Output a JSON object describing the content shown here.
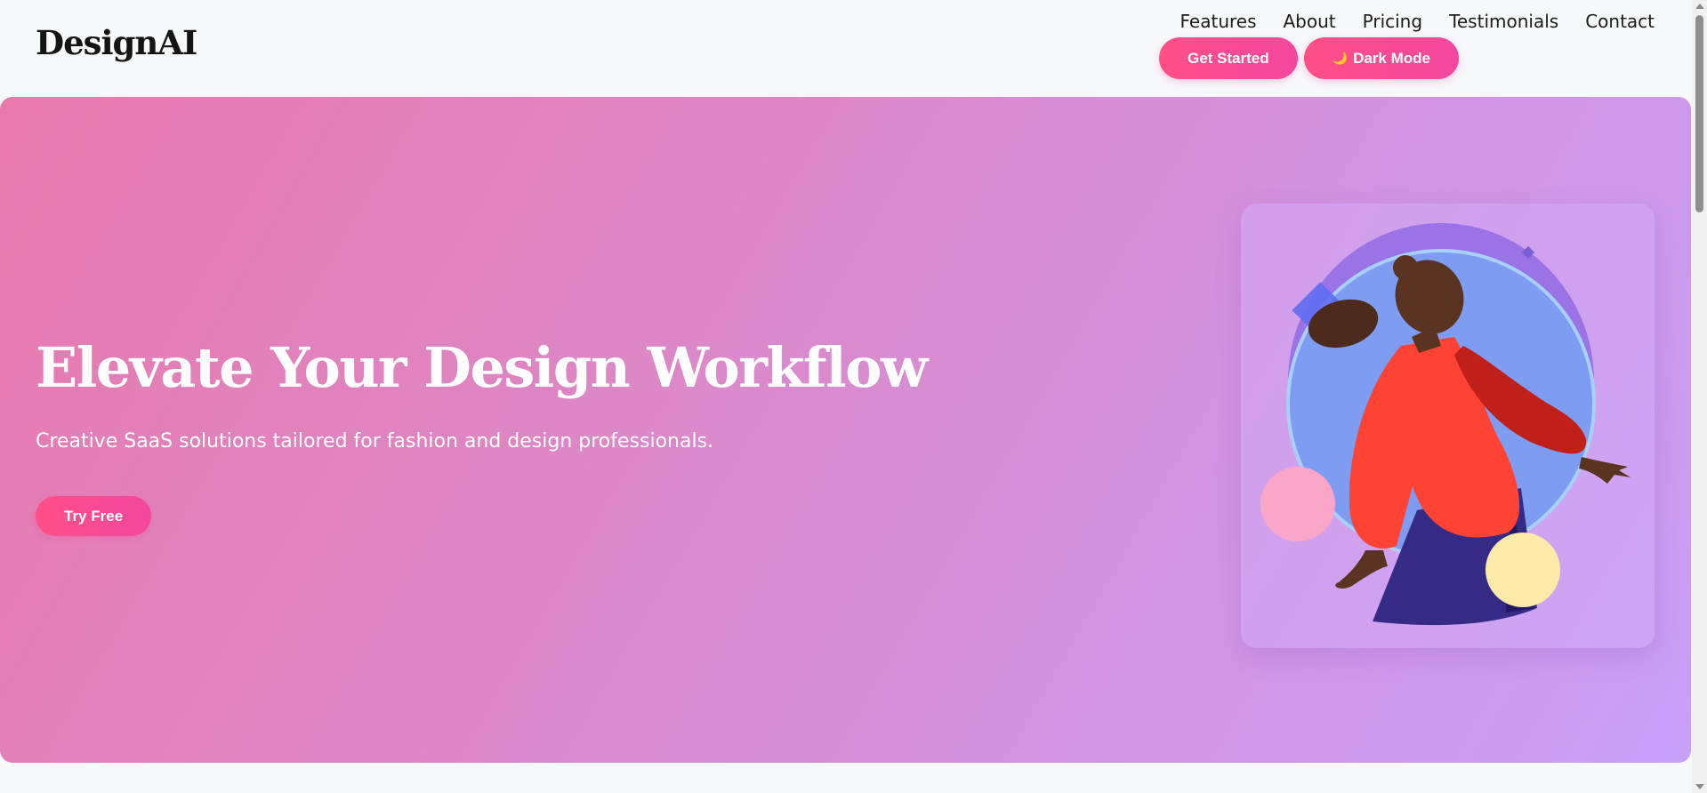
{
  "brand": {
    "logo_text": "DesignAI"
  },
  "nav": {
    "items": [
      "Features",
      "About",
      "Pricing",
      "Testimonials",
      "Contact"
    ]
  },
  "header_buttons": {
    "get_started": "Get Started",
    "dark_mode_icon": "🌙",
    "dark_mode": "Dark Mode"
  },
  "hero": {
    "title": "Elevate Your Design Workflow",
    "subtitle": "Creative SaaS solutions tailored for fashion and design professionals.",
    "cta": "Try Free",
    "illustration_icon": "woman-with-circles-illustration"
  },
  "colors": {
    "accent": "#ff4f87",
    "hero_gradient_start": "#e879ad",
    "hero_gradient_end": "#c7a0f8",
    "background": "#f7f8fa"
  }
}
